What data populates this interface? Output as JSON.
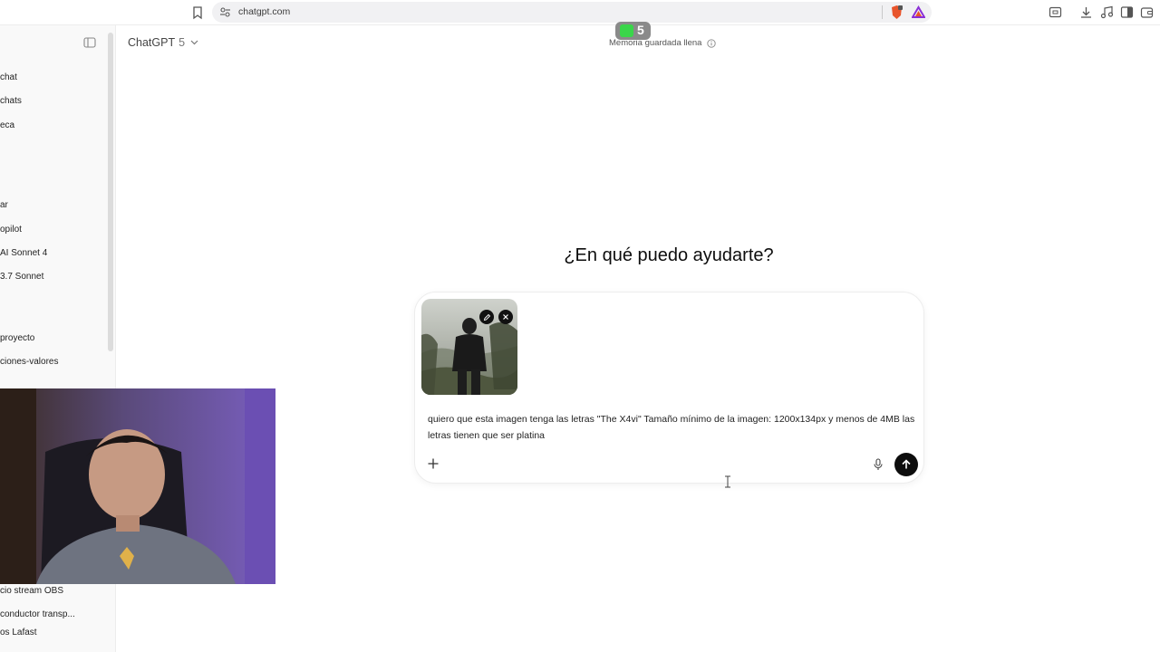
{
  "browser": {
    "url": "chatgpt.com",
    "colors": {
      "shield": "#e8552c",
      "rewards": "#8b2fd6"
    }
  },
  "sidebar": {
    "items_top": [
      {
        "label": "chat"
      },
      {
        "label": "chats"
      },
      {
        "label": "eca"
      },
      {
        "label": "ar"
      },
      {
        "label": "opilot"
      },
      {
        "label": "AI Sonnet 4"
      },
      {
        "label": "3.7 Sonnet"
      },
      {
        "label": "proyecto"
      },
      {
        "label": "ciones-valores"
      }
    ],
    "items_bottom": [
      {
        "label": "cio stream OBS"
      },
      {
        "label": "conductor transp..."
      },
      {
        "label": "os Lafast"
      }
    ]
  },
  "header": {
    "model_name": "ChatGPT",
    "model_version": "5",
    "memory_status": "Memoria guardada llena",
    "overlay_number": "5"
  },
  "main": {
    "title": "¿En qué puedo ayudarte?",
    "composer": {
      "text": "quiero que esta imagen tenga las letras \"The X4vi\" Tamaño mínimo de la imagen: 1200x134px y menos de 4MB las letras tienen que ser platina"
    }
  },
  "colors": {
    "send_button": "#0d0d0d",
    "sidebar_bg": "#f9f9f9",
    "overlay_green": "#3ad64a"
  }
}
